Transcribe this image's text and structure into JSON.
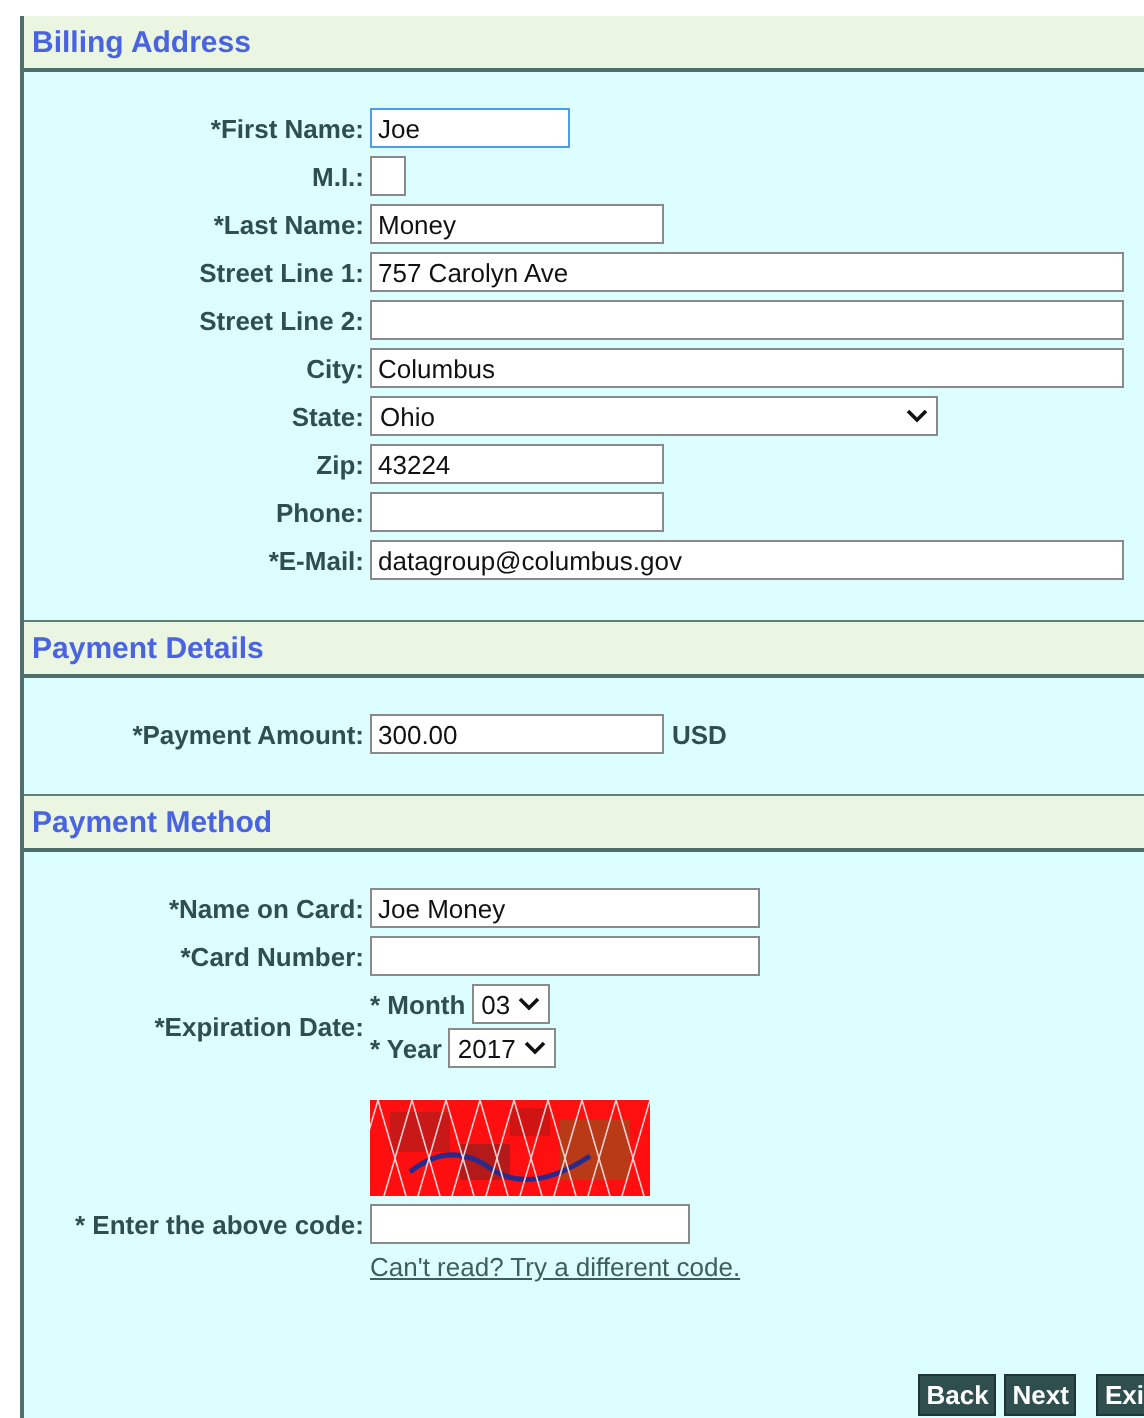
{
  "sections": [
    {
      "title": "Billing Address",
      "rows": [
        {
          "kind": "short-text",
          "label": "*First Name:",
          "value": "Joe",
          "focused": true
        },
        {
          "kind": "tiny-text",
          "label": "M.I.:",
          "focused": false
        },
        {
          "kind": "mid-text",
          "label": "*Last Name:",
          "value": "Money",
          "focused": false
        },
        {
          "kind": "long-text",
          "label": "Street Line 1:",
          "value": "757 Carolyn Ave",
          "focused": false
        },
        {
          "kind": "long-text",
          "label": "Street Line 2:",
          "focused": false
        },
        {
          "kind": "long-text",
          "label": "City:",
          "value": "Columbus",
          "focused": false
        },
        {
          "kind": "select",
          "label": "State:",
          "value": "Ohio"
        },
        {
          "kind": "mid-text",
          "label": "Zip:",
          "value": "43224",
          "focused": false
        },
        {
          "kind": "mid-text",
          "label": "Phone:",
          "focused": false
        },
        {
          "kind": "long-text",
          "label": "*E-Mail:",
          "value": "datagroup@columbus.gov",
          "focused": false
        }
      ]
    },
    {
      "title": "Payment Details",
      "rows": [
        {
          "kind": "mid-text",
          "label": "*Payment Amount:",
          "value": "300.00",
          "suffix": "USD",
          "focused": false
        }
      ]
    },
    {
      "title": "Payment Method",
      "rows": [
        {
          "kind": "card-text",
          "label": "*Name on Card:",
          "value": "Joe Money",
          "focused": false
        },
        {
          "kind": "card-text",
          "label": "*Card Number:",
          "focused": false
        },
        {
          "kind": "expiry",
          "label": "*Expiration Date:",
          "parts": [
            {
              "label": "* Month",
              "value": "03"
            },
            {
              "label": "* Year",
              "value": "2017"
            }
          ]
        },
        {
          "kind": "captcha"
        },
        {
          "kind": "code-text",
          "label": "* Enter the above code:",
          "focused": false
        },
        {
          "kind": "link",
          "text": "Can't read? Try a different code."
        }
      ]
    }
  ],
  "buttons": [
    "Back",
    "Next",
    "Exi"
  ]
}
